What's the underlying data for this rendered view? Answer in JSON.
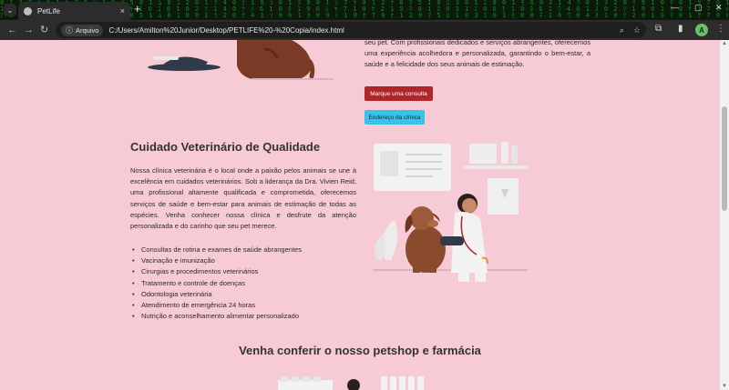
{
  "browser": {
    "tab_title": "PetLife",
    "tab_close": "×",
    "new_tab": "+",
    "window_controls": [
      "⌄",
      "—",
      "▢",
      "✕"
    ],
    "site_chip": "Arquivo",
    "url": "C:/Users/Amilton%20Junior/Desktop/PETLIFE%20-%20Copia/index.html",
    "profile_initial": "A"
  },
  "intro": {
    "text": "seu pet. Com profissionais dedicados e serviços abrangentes, oferecemos uma experiência acolhedora e personalizada, garantindo o bem-estar, a saúde e a felicidade dos seus animais de estimação."
  },
  "buttons": {
    "consulta": "Marque uma consulta",
    "endereco": "Endereço da clínica"
  },
  "section_vet": {
    "title": "Cuidado Veterinário de Qualidade",
    "description": "Nossa clínica veterinária é o local onde a paixão pelos animais se une à excelência em cuidados veterinários. Sob a liderança da Dra. Vivien Reid, uma profissional altamente qualificada e comprometida, oferecemos serviços de saúde e bem-estar para animais de estimação de todas as espécies. Venha conhecer nossa clínica e desfrute da atenção personalizada e do carinho que seu pet merece.",
    "services": [
      "Consultas de rotina e exames de saúde abrangentes",
      "Vacinação e imunização",
      "Cirurgias e procedimentos veterinários",
      "Tratamento e controle de doenças",
      "Odontologia veterinária",
      "Atendimento de emergência 24 horas",
      "Nutrição e aconselhamento alimentar personalizado"
    ]
  },
  "section_shop": {
    "title": "Venha conferir o nosso petshop e farmácia"
  },
  "colors": {
    "page_bg": "#f6cbd6",
    "button_red": "#b0252a",
    "button_cyan": "#38c4ea"
  }
}
